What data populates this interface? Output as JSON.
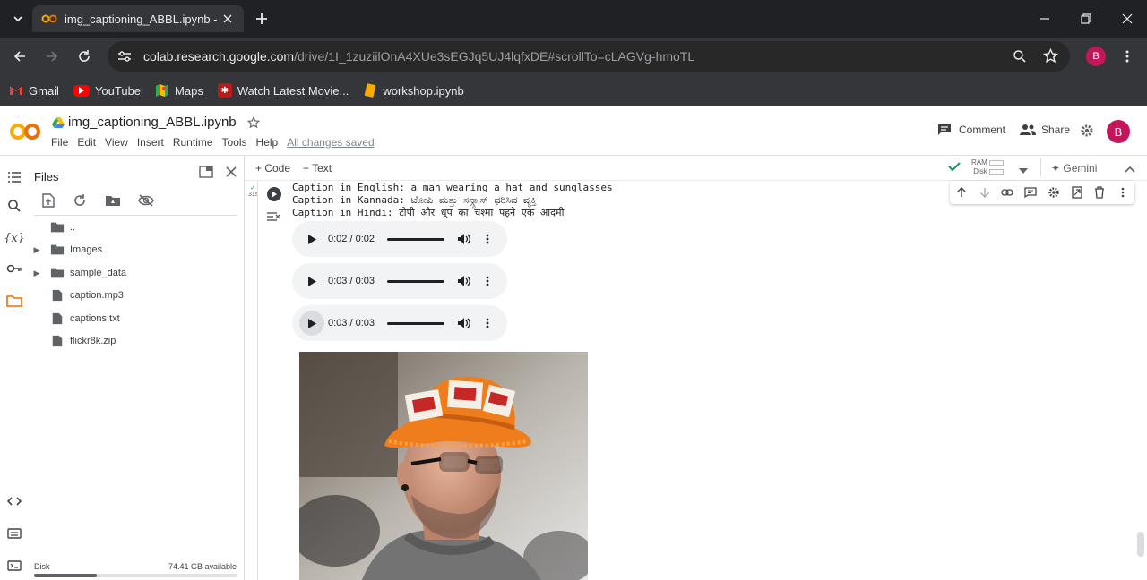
{
  "browser": {
    "tab_title": "img_captioning_ABBL.ipynb - C",
    "url_host": "colab.research.google.com",
    "url_path": "/drive/1I_1zuziilOnA4XUe3sEGJq5UJ4lqfxDE#scrollTo=cLAGVg-hmoTL",
    "profile_initial": "B",
    "bookmarks": [
      {
        "label": "Gmail",
        "icon": "gmail-icon"
      },
      {
        "label": "YouTube",
        "icon": "youtube-icon"
      },
      {
        "label": "Maps",
        "icon": "maps-icon"
      },
      {
        "label": "Watch Latest Movie...",
        "icon": "movie-site-icon"
      },
      {
        "label": "workshop.ipynb",
        "icon": "colab-notebook-icon"
      }
    ]
  },
  "colab": {
    "notebook_title": "img_captioning_ABBL.ipynb",
    "menu": [
      "File",
      "Edit",
      "View",
      "Insert",
      "Runtime",
      "Tools",
      "Help"
    ],
    "save_status": "All changes saved",
    "comment_label": "Comment",
    "share_label": "Share",
    "user_initial": "B",
    "add_code_label": "Code",
    "add_text_label": "Text",
    "ram_label": "RAM",
    "disk_label": "Disk",
    "gemini_label": "Gemini"
  },
  "files_panel": {
    "title": "Files",
    "items": [
      {
        "name": "..",
        "type": "folder-up"
      },
      {
        "name": "Images",
        "type": "folder"
      },
      {
        "name": "sample_data",
        "type": "folder"
      },
      {
        "name": "caption.mp3",
        "type": "file"
      },
      {
        "name": "captions.txt",
        "type": "file"
      },
      {
        "name": "flickr8k.zip",
        "type": "file"
      }
    ],
    "disk_label": "Disk",
    "disk_available": "74.41 GB available"
  },
  "cell": {
    "exec_time": "31s",
    "output_lines": [
      "Caption in English: a man wearing a hat and sunglasses",
      "Caption in Kannada: ಟೋಪಿ ಮತ್ತು ಸನ್ಗ್ಲಾಸ್ ಧರಿಸಿದ ವ್ಯಕ್ತಿ",
      "Caption in Hindi: टोपी और धूप का चश्मा पहने एक आदमी"
    ],
    "audio_players": [
      {
        "time": "0:02 / 0:02"
      },
      {
        "time": "0:03 / 0:03"
      },
      {
        "time": "0:03 / 0:03"
      }
    ]
  },
  "colors": {
    "chrome_dark": "#202124",
    "chrome_mid": "#35363a",
    "colab_orange": "#f9ab00",
    "avatar": "#c2185b"
  }
}
